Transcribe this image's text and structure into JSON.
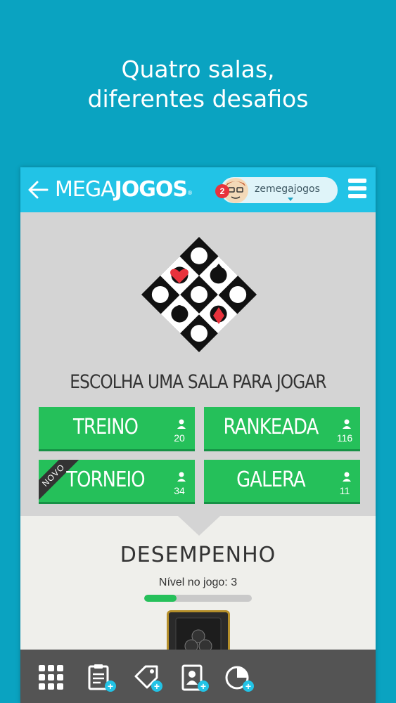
{
  "headline": [
    "Quatro salas,",
    "diferentes desafios"
  ],
  "topbar": {
    "logo_light": "MEGA",
    "logo_bold": "JOGOS",
    "logo_reg": "®",
    "notification_count": "2",
    "username": "zemegajogos"
  },
  "choose_title": "ESCOLHA UMA SALA PARA JOGAR",
  "rooms": [
    {
      "label": "TREINO",
      "count": "20",
      "badge": ""
    },
    {
      "label": "RANKEADA",
      "count": "116",
      "badge": ""
    },
    {
      "label": "TORNEIO",
      "count": "34",
      "badge": "NOVO"
    },
    {
      "label": "GALERA",
      "count": "11",
      "badge": ""
    }
  ],
  "performance": {
    "title": "DESEMPENHO",
    "level_text": "Nível no jogo: 3",
    "progress_fraction": 0.3
  },
  "bottom_nav": [
    {
      "icon": "grid-icon",
      "plus": ""
    },
    {
      "icon": "clipboard-icon",
      "plus": "+"
    },
    {
      "icon": "tag-icon",
      "plus": "+"
    },
    {
      "icon": "contact-card-icon",
      "plus": "+"
    },
    {
      "icon": "pie-chart-icon",
      "plus": "+"
    }
  ],
  "colors": {
    "background": "#0aa3c1",
    "topbar": "#22c3e6",
    "room_green": "#25c05a",
    "bottom_bar": "#545454",
    "suit_red": "#e8323c"
  }
}
